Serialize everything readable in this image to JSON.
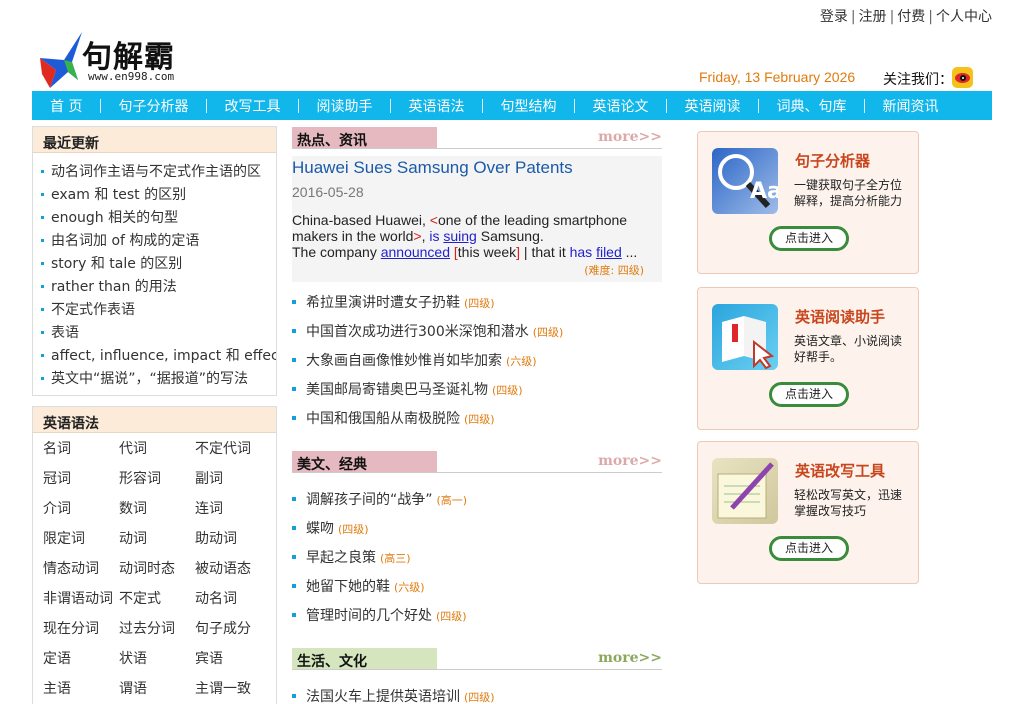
{
  "toplinks": {
    "login": "登录",
    "register": "注册",
    "pay": "付费",
    "user_center": "个人中心"
  },
  "logo": {
    "text": "句解霸",
    "url": "www.en998.com"
  },
  "header": {
    "date": "Friday, 13 February 2026",
    "follow": "关注我们："
  },
  "nav": [
    "首 页",
    "句子分析器",
    "改写工具",
    "阅读助手",
    "英语语法",
    "句型结构",
    "英语论文",
    "英语阅读",
    "词典、句库",
    "新闻资讯"
  ],
  "recent": {
    "title": "最近更新",
    "items": [
      "动名词作主语与不定式作主语的区",
      "exam 和 test 的区别",
      "enough 相关的句型",
      "由名词加 of 构成的定语",
      "story 和 tale 的区别",
      "rather than 的用法",
      "不定式作表语",
      "表语",
      "affect, influence, impact 和 effect",
      "英文中“据说”，“据报道”的写法"
    ]
  },
  "grammar": {
    "title": "英语语法",
    "items": [
      "名词",
      "代词",
      "不定代词",
      "冠词",
      "形容词",
      "副词",
      "介词",
      "数词",
      "连词",
      "限定词",
      "动词",
      "助动词",
      "情态动词",
      "动词时态",
      "被动语态",
      "非谓语动词",
      "不定式",
      "动名词",
      "现在分词",
      "过去分词",
      "句子成分",
      "定语",
      "状语",
      "宾语",
      "主语",
      "谓语",
      "主谓一致"
    ]
  },
  "news": {
    "title": "热点、资讯",
    "more": "more>>",
    "feature": {
      "title": "Huawei Sues Samsung Over Patents",
      "date": "2016-05-28",
      "line1_a": "China-based Huawei, ",
      "line1_b": "<",
      "line1_c": "one of the leading smartphone makers in the world",
      "line1_d": ">",
      "line1_e": ", ",
      "line1_f": "is",
      "line1_g": " ",
      "line1_h": "suing",
      "line1_i": " Samsung.",
      "line2_a": "The company ",
      "line2_b": "announced",
      "line2_c": " ",
      "line2_d": "[",
      "line2_e": "this week",
      "line2_f": "]",
      "line2_g": " | that it ",
      "line2_h": "has",
      "line2_i": " ",
      "line2_j": "filed",
      "line2_k": " ...",
      "level": "(难度: 四级)"
    },
    "items": [
      {
        "text": "希拉里演讲时遭女子扔鞋",
        "level": "(四级)"
      },
      {
        "text": "中国首次成功进行300米深饱和潜水",
        "level": "(四级)"
      },
      {
        "text": "大象画自画像惟妙惟肖如毕加索",
        "level": "(六级)"
      },
      {
        "text": "美国邮局寄错奥巴马圣诞礼物",
        "level": "(四级)"
      },
      {
        "text": "中国和俄国船从南极脱险",
        "level": "(四级)"
      }
    ]
  },
  "classics": {
    "title": "美文、经典",
    "more": "more>>",
    "items": [
      {
        "text": "调解孩子间的“战争”",
        "level": "(高一)"
      },
      {
        "text": "蝶吻",
        "level": "(四级)"
      },
      {
        "text": "早起之良策",
        "level": "(高三)"
      },
      {
        "text": "她留下她的鞋",
        "level": "(六级)"
      },
      {
        "text": "管理时间的几个好处",
        "level": "(四级)"
      }
    ]
  },
  "life": {
    "title": "生活、文化",
    "more": "more>>",
    "items": [
      {
        "text": "法国火车上提供英语培训",
        "level": "(四级)"
      }
    ]
  },
  "promos": [
    {
      "title": "句子分析器",
      "desc": "一键获取句子全方位解释，提高分析能力",
      "button": "点击进入",
      "icon": "magnifier-aa-icon"
    },
    {
      "title": "英语阅读助手",
      "desc": "英语文章、小说阅读好帮手。",
      "button": "点击进入",
      "icon": "book-cursor-icon"
    },
    {
      "title": "英语改写工具",
      "desc": "轻松改写英文，迅速掌握改写技巧",
      "button": "点击进入",
      "icon": "pen-paper-icon"
    }
  ],
  "colors": {
    "nav_bg": "#11b6ea",
    "accent_orange": "#e07b0e",
    "promo_title": "#c8461e",
    "link_blue": "#1a5aa8"
  }
}
